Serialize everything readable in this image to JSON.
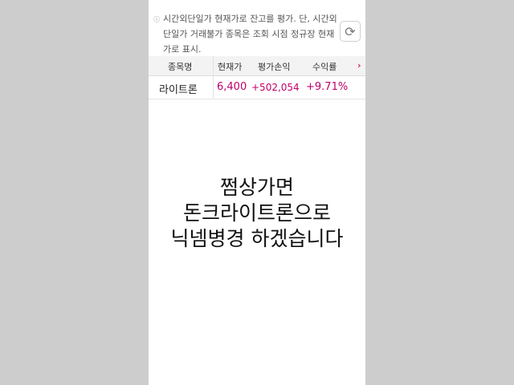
{
  "notice": {
    "text": "시간외단일가 현재가로 잔고를 평가. 단, 시간외단일가 거래불가 종목은 조회 시점 정규장 현재가로 표시."
  },
  "table": {
    "headers": [
      "종목명",
      "현재가",
      "평가손익",
      "수익률"
    ],
    "rows": [
      {
        "name": "라이트론",
        "price": "6,400",
        "pl": "+502,054",
        "rate": "+9.71%"
      }
    ]
  },
  "caption": {
    "line1": "쩜상가면",
    "line2": "돈크라이트론으로",
    "line3": "닉넴병경 하겠습니다"
  },
  "colors": {
    "up": "#c0006a"
  }
}
